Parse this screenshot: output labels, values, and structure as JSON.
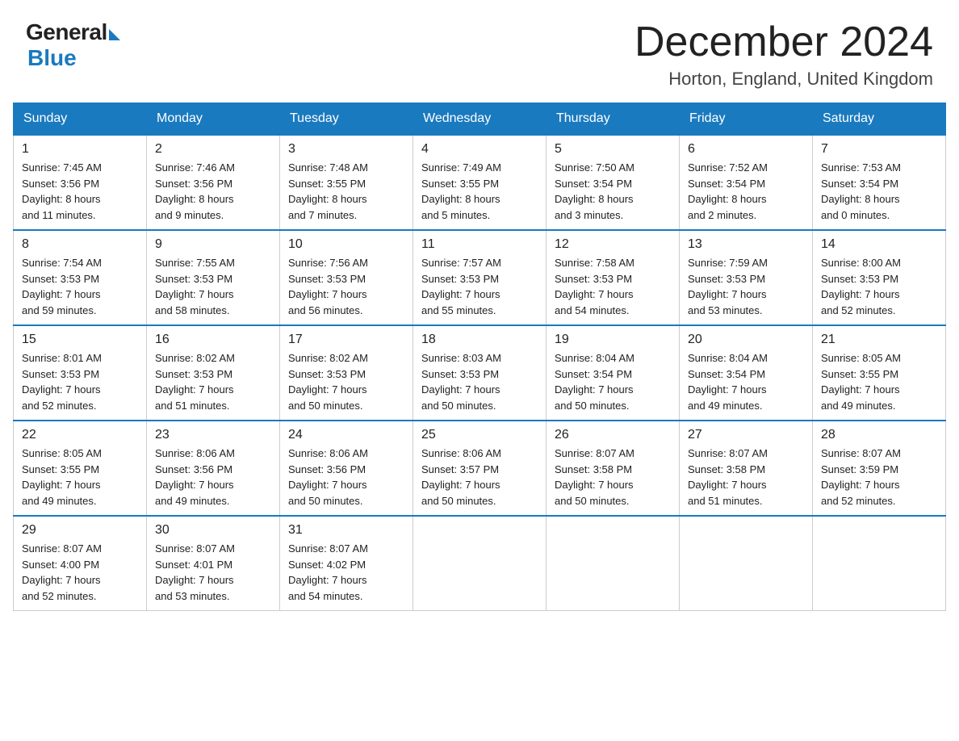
{
  "header": {
    "logo_general": "General",
    "logo_blue": "Blue",
    "main_title": "December 2024",
    "subtitle": "Horton, England, United Kingdom"
  },
  "calendar": {
    "days_of_week": [
      "Sunday",
      "Monday",
      "Tuesday",
      "Wednesday",
      "Thursday",
      "Friday",
      "Saturday"
    ],
    "weeks": [
      [
        {
          "num": "1",
          "info": "Sunrise: 7:45 AM\nSunset: 3:56 PM\nDaylight: 8 hours\nand 11 minutes."
        },
        {
          "num": "2",
          "info": "Sunrise: 7:46 AM\nSunset: 3:56 PM\nDaylight: 8 hours\nand 9 minutes."
        },
        {
          "num": "3",
          "info": "Sunrise: 7:48 AM\nSunset: 3:55 PM\nDaylight: 8 hours\nand 7 minutes."
        },
        {
          "num": "4",
          "info": "Sunrise: 7:49 AM\nSunset: 3:55 PM\nDaylight: 8 hours\nand 5 minutes."
        },
        {
          "num": "5",
          "info": "Sunrise: 7:50 AM\nSunset: 3:54 PM\nDaylight: 8 hours\nand 3 minutes."
        },
        {
          "num": "6",
          "info": "Sunrise: 7:52 AM\nSunset: 3:54 PM\nDaylight: 8 hours\nand 2 minutes."
        },
        {
          "num": "7",
          "info": "Sunrise: 7:53 AM\nSunset: 3:54 PM\nDaylight: 8 hours\nand 0 minutes."
        }
      ],
      [
        {
          "num": "8",
          "info": "Sunrise: 7:54 AM\nSunset: 3:53 PM\nDaylight: 7 hours\nand 59 minutes."
        },
        {
          "num": "9",
          "info": "Sunrise: 7:55 AM\nSunset: 3:53 PM\nDaylight: 7 hours\nand 58 minutes."
        },
        {
          "num": "10",
          "info": "Sunrise: 7:56 AM\nSunset: 3:53 PM\nDaylight: 7 hours\nand 56 minutes."
        },
        {
          "num": "11",
          "info": "Sunrise: 7:57 AM\nSunset: 3:53 PM\nDaylight: 7 hours\nand 55 minutes."
        },
        {
          "num": "12",
          "info": "Sunrise: 7:58 AM\nSunset: 3:53 PM\nDaylight: 7 hours\nand 54 minutes."
        },
        {
          "num": "13",
          "info": "Sunrise: 7:59 AM\nSunset: 3:53 PM\nDaylight: 7 hours\nand 53 minutes."
        },
        {
          "num": "14",
          "info": "Sunrise: 8:00 AM\nSunset: 3:53 PM\nDaylight: 7 hours\nand 52 minutes."
        }
      ],
      [
        {
          "num": "15",
          "info": "Sunrise: 8:01 AM\nSunset: 3:53 PM\nDaylight: 7 hours\nand 52 minutes."
        },
        {
          "num": "16",
          "info": "Sunrise: 8:02 AM\nSunset: 3:53 PM\nDaylight: 7 hours\nand 51 minutes."
        },
        {
          "num": "17",
          "info": "Sunrise: 8:02 AM\nSunset: 3:53 PM\nDaylight: 7 hours\nand 50 minutes."
        },
        {
          "num": "18",
          "info": "Sunrise: 8:03 AM\nSunset: 3:53 PM\nDaylight: 7 hours\nand 50 minutes."
        },
        {
          "num": "19",
          "info": "Sunrise: 8:04 AM\nSunset: 3:54 PM\nDaylight: 7 hours\nand 50 minutes."
        },
        {
          "num": "20",
          "info": "Sunrise: 8:04 AM\nSunset: 3:54 PM\nDaylight: 7 hours\nand 49 minutes."
        },
        {
          "num": "21",
          "info": "Sunrise: 8:05 AM\nSunset: 3:55 PM\nDaylight: 7 hours\nand 49 minutes."
        }
      ],
      [
        {
          "num": "22",
          "info": "Sunrise: 8:05 AM\nSunset: 3:55 PM\nDaylight: 7 hours\nand 49 minutes."
        },
        {
          "num": "23",
          "info": "Sunrise: 8:06 AM\nSunset: 3:56 PM\nDaylight: 7 hours\nand 49 minutes."
        },
        {
          "num": "24",
          "info": "Sunrise: 8:06 AM\nSunset: 3:56 PM\nDaylight: 7 hours\nand 50 minutes."
        },
        {
          "num": "25",
          "info": "Sunrise: 8:06 AM\nSunset: 3:57 PM\nDaylight: 7 hours\nand 50 minutes."
        },
        {
          "num": "26",
          "info": "Sunrise: 8:07 AM\nSunset: 3:58 PM\nDaylight: 7 hours\nand 50 minutes."
        },
        {
          "num": "27",
          "info": "Sunrise: 8:07 AM\nSunset: 3:58 PM\nDaylight: 7 hours\nand 51 minutes."
        },
        {
          "num": "28",
          "info": "Sunrise: 8:07 AM\nSunset: 3:59 PM\nDaylight: 7 hours\nand 52 minutes."
        }
      ],
      [
        {
          "num": "29",
          "info": "Sunrise: 8:07 AM\nSunset: 4:00 PM\nDaylight: 7 hours\nand 52 minutes."
        },
        {
          "num": "30",
          "info": "Sunrise: 8:07 AM\nSunset: 4:01 PM\nDaylight: 7 hours\nand 53 minutes."
        },
        {
          "num": "31",
          "info": "Sunrise: 8:07 AM\nSunset: 4:02 PM\nDaylight: 7 hours\nand 54 minutes."
        },
        {
          "num": "",
          "info": ""
        },
        {
          "num": "",
          "info": ""
        },
        {
          "num": "",
          "info": ""
        },
        {
          "num": "",
          "info": ""
        }
      ]
    ]
  }
}
